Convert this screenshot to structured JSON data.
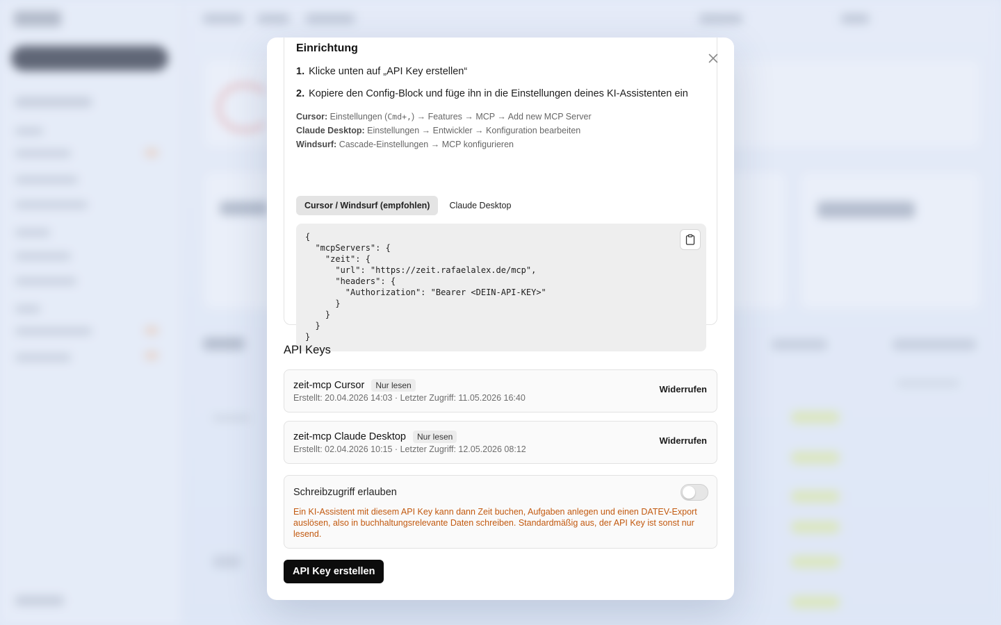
{
  "modal": {
    "setup": {
      "title": "Einrichtung",
      "steps": [
        {
          "num": "1.",
          "text": "Klicke unten auf „API Key erstellen“"
        },
        {
          "num": "2.",
          "text": "Kopiere den Config-Block und füge ihn in die Einstellungen deines KI-Assistenten ein"
        }
      ],
      "hints": [
        {
          "label": "Cursor:",
          "pre": "Einstellungen (",
          "code": "Cmd+,",
          "post": ") → Features → MCP → Add new MCP Server"
        },
        {
          "label": "Claude Desktop:",
          "text": "Einstellungen → Entwickler → Konfiguration bearbeiten"
        },
        {
          "label": "Windsurf:",
          "text": "Cascade-Einstellungen → MCP konfigurieren"
        }
      ],
      "tabs": [
        {
          "label": "Cursor / Windsurf (empfohlen)",
          "active": true
        },
        {
          "label": "Claude Desktop",
          "active": false
        }
      ],
      "code": "{\n  \"mcpServers\": {\n    \"zeit\": {\n      \"url\": \"https://zeit.rafaelalex.de/mcp\",\n      \"headers\": {\n        \"Authorization\": \"Bearer <DEIN-API-KEY>\"\n      }\n    }\n  }\n}",
      "copy_icon": "clipboard-icon"
    },
    "close_icon": "close-icon",
    "api_keys": {
      "title": "API Keys",
      "items": [
        {
          "name": "zeit-mcp Cursor",
          "badge": "Nur lesen",
          "meta": "Erstellt: 20.04.2026 14:03 · Letzter Zugriff: 11.05.2026 16:40",
          "action": "Widerrufen"
        },
        {
          "name": "zeit-mcp Claude Desktop",
          "badge": "Nur lesen",
          "meta": "Erstellt: 02.04.2026 10:15 · Letzter Zugriff: 12.05.2026 08:12",
          "action": "Widerrufen"
        }
      ]
    },
    "write_access": {
      "title": "Schreibzugriff erlauben",
      "enabled": false,
      "warning": "Ein KI-Assistent mit diesem API Key kann dann Zeit buchen, Aufgaben anlegen und einen DATEV-Export auslösen, also in buchhaltungsrelevante Daten schreiben. Standardmäßig aus, der API Key ist sonst nur lesend.",
      "warning_color": "#c2590f"
    },
    "create_button": "API Key erstellen"
  }
}
